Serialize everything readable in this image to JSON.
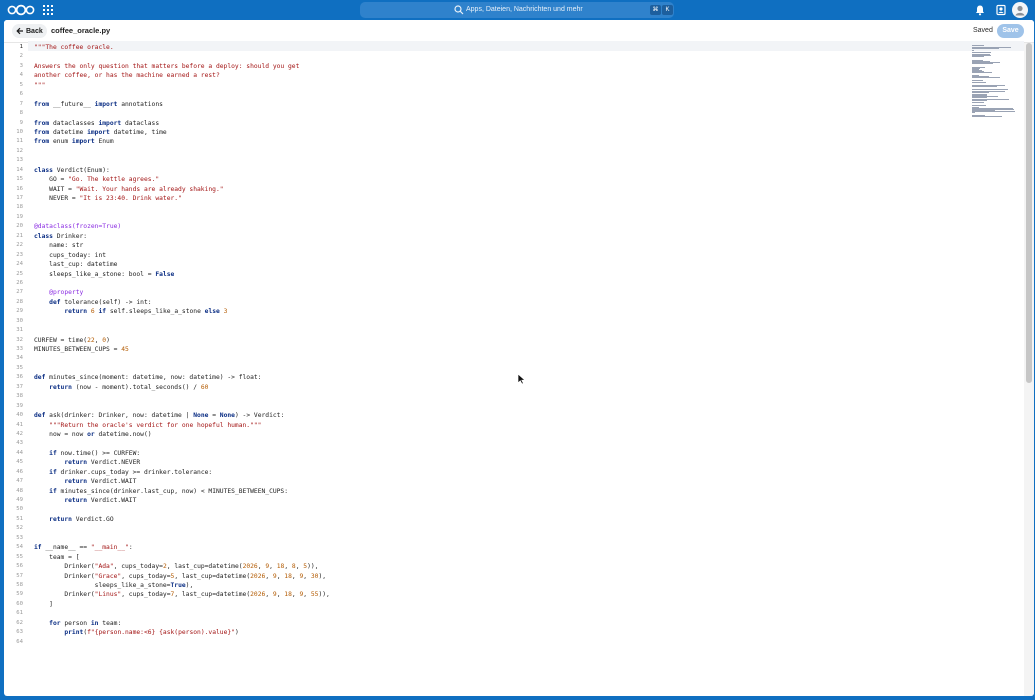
{
  "topbar": {
    "search_placeholder": "Apps, Dateien, Nachrichten und mehr",
    "shortcut_mod": "⌘",
    "shortcut_key": "K",
    "brand_color": "#0f6fc1"
  },
  "editor": {
    "back_label": "Back",
    "file_name": "coffee_oracle.py",
    "status": "Saved",
    "save_label": "Save",
    "active_line": 1,
    "lines": [
      "\"\"\"The coffee oracle.",
      "",
      "Answers the only question that matters before a deploy: should you get",
      "another coffee, or has the machine earned a rest?",
      "\"\"\"",
      "",
      "from __future__ import annotations",
      "",
      "from dataclasses import dataclass",
      "from datetime import datetime, time",
      "from enum import Enum",
      "",
      "",
      "class Verdict(Enum):",
      "    GO = \"Go. The kettle agrees.\"",
      "    WAIT = \"Wait. Your hands are already shaking.\"",
      "    NEVER = \"It is 23:40. Drink water.\"",
      "",
      "",
      "@dataclass(frozen=True)",
      "class Drinker:",
      "    name: str",
      "    cups_today: int",
      "    last_cup: datetime",
      "    sleeps_like_a_stone: bool = False",
      "",
      "    @property",
      "    def tolerance(self) -> int:",
      "        return 6 if self.sleeps_like_a_stone else 3",
      "",
      "",
      "CURFEW = time(22, 0)",
      "MINUTES_BETWEEN_CUPS = 45",
      "",
      "",
      "def minutes_since(moment: datetime, now: datetime) -> float:",
      "    return (now - moment).total_seconds() / 60",
      "",
      "",
      "def ask(drinker: Drinker, now: datetime | None = None) -> Verdict:",
      "    \"\"\"Return the oracle's verdict for one hopeful human.\"\"\"",
      "    now = now or datetime.now()",
      "",
      "    if now.time() >= CURFEW:",
      "        return Verdict.NEVER",
      "    if drinker.cups_today >= drinker.tolerance:",
      "        return Verdict.WAIT",
      "    if minutes_since(drinker.last_cup, now) < MINUTES_BETWEEN_CUPS:",
      "        return Verdict.WAIT",
      "",
      "    return Verdict.GO",
      "",
      "",
      "if __name__ == \"__main__\":",
      "    team = [",
      "        Drinker(\"Ada\", cups_today=2, last_cup=datetime(2026, 9, 18, 8, 5)),",
      "        Drinker(\"Grace\", cups_today=5, last_cup=datetime(2026, 9, 18, 9, 30),",
      "                sleeps_like_a_stone=True),",
      "        Drinker(\"Linus\", cups_today=7, last_cup=datetime(2026, 9, 18, 9, 55)),",
      "    ]",
      "",
      "    for person in team:",
      "        print(f\"{person.name:<6} {ask(person).value}\")",
      ""
    ]
  },
  "colors": {
    "keyword": "#0b2e84",
    "string": "#a31515",
    "decorator": "#8a2be2",
    "number": "#b35a00"
  }
}
